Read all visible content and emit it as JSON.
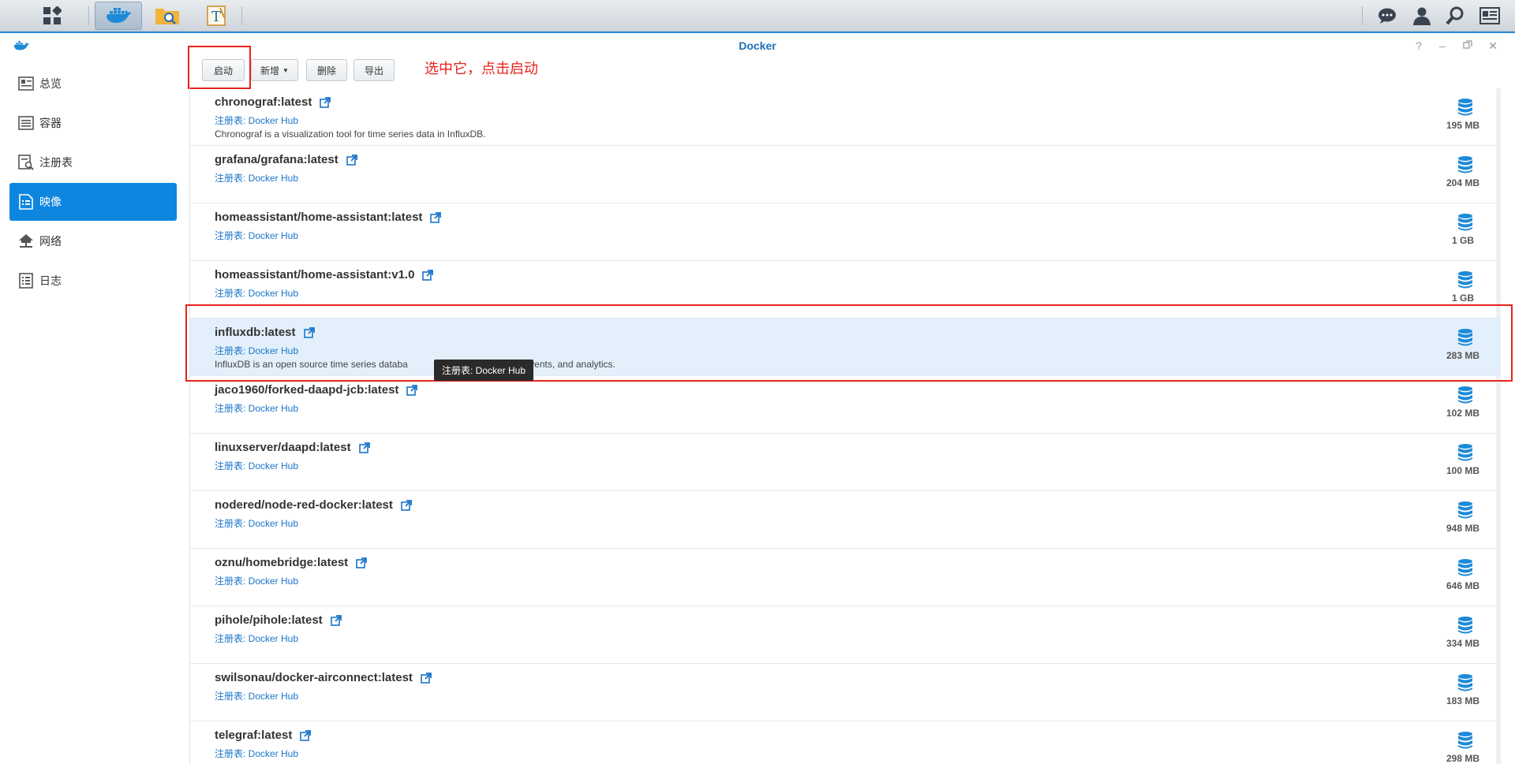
{
  "taskbar": {
    "apps": [
      {
        "name": "main-menu",
        "icon": "grid-icon"
      },
      {
        "name": "docker",
        "icon": "docker-whale-icon",
        "active": true
      },
      {
        "name": "file-station",
        "icon": "folder-search-icon"
      },
      {
        "name": "text-editor",
        "icon": "text-editor-icon"
      }
    ],
    "right": [
      "chat-icon",
      "user-icon",
      "search-icon",
      "widgets-icon"
    ]
  },
  "window": {
    "title": "Docker"
  },
  "sidebar": {
    "items": [
      {
        "label": "总览",
        "icon": "overview-icon"
      },
      {
        "label": "容器",
        "icon": "container-icon"
      },
      {
        "label": "注册表",
        "icon": "registry-icon"
      },
      {
        "label": "映像",
        "icon": "image-icon",
        "active": true
      },
      {
        "label": "网络",
        "icon": "network-icon"
      },
      {
        "label": "日志",
        "icon": "log-icon"
      }
    ]
  },
  "toolbar": {
    "launch": "启动",
    "add": "新增",
    "delete": "删除",
    "export": "导出"
  },
  "annotation": {
    "text": "选中它，点击启动"
  },
  "images": [
    {
      "name": "chronograf:latest",
      "registry": "注册表: Docker Hub",
      "desc": "Chronograf is a visualization tool for time series data in InfluxDB.",
      "size": "195 MB"
    },
    {
      "name": "grafana/grafana:latest",
      "registry": "注册表: Docker Hub",
      "desc": "",
      "size": "204 MB"
    },
    {
      "name": "homeassistant/home-assistant:latest",
      "registry": "注册表: Docker Hub",
      "desc": "",
      "size": "1 GB"
    },
    {
      "name": "homeassistant/home-assistant:v1.0",
      "registry": "注册表: Docker Hub",
      "desc": "",
      "size": "1 GB"
    },
    {
      "name": "influxdb:latest",
      "registry": "注册表: Docker Hub",
      "desc": "InfluxDB is an open source time series databa",
      "desc_tail": "s, events, and analytics.",
      "size": "283 MB",
      "selected": true
    },
    {
      "name": "jaco1960/forked-daapd-jcb:latest",
      "registry": "注册表: Docker Hub",
      "desc": "",
      "size": "102 MB"
    },
    {
      "name": "linuxserver/daapd:latest",
      "registry": "注册表: Docker Hub",
      "desc": "",
      "size": "100 MB"
    },
    {
      "name": "nodered/node-red-docker:latest",
      "registry": "注册表: Docker Hub",
      "desc": "",
      "size": "948 MB"
    },
    {
      "name": "oznu/homebridge:latest",
      "registry": "注册表: Docker Hub",
      "desc": "",
      "size": "646 MB"
    },
    {
      "name": "pihole/pihole:latest",
      "registry": "注册表: Docker Hub",
      "desc": "",
      "size": "334 MB"
    },
    {
      "name": "swilsonau/docker-airconnect:latest",
      "registry": "注册表: Docker Hub",
      "desc": "",
      "size": "183 MB"
    },
    {
      "name": "telegraf:latest",
      "registry": "注册表: Docker Hub",
      "desc": "",
      "size": "298 MB"
    }
  ],
  "tooltip": {
    "text": "注册表: Docker Hub"
  },
  "colors": {
    "accent": "#0e86e0",
    "link": "#1a75c9",
    "annotation": "#e8231c"
  }
}
